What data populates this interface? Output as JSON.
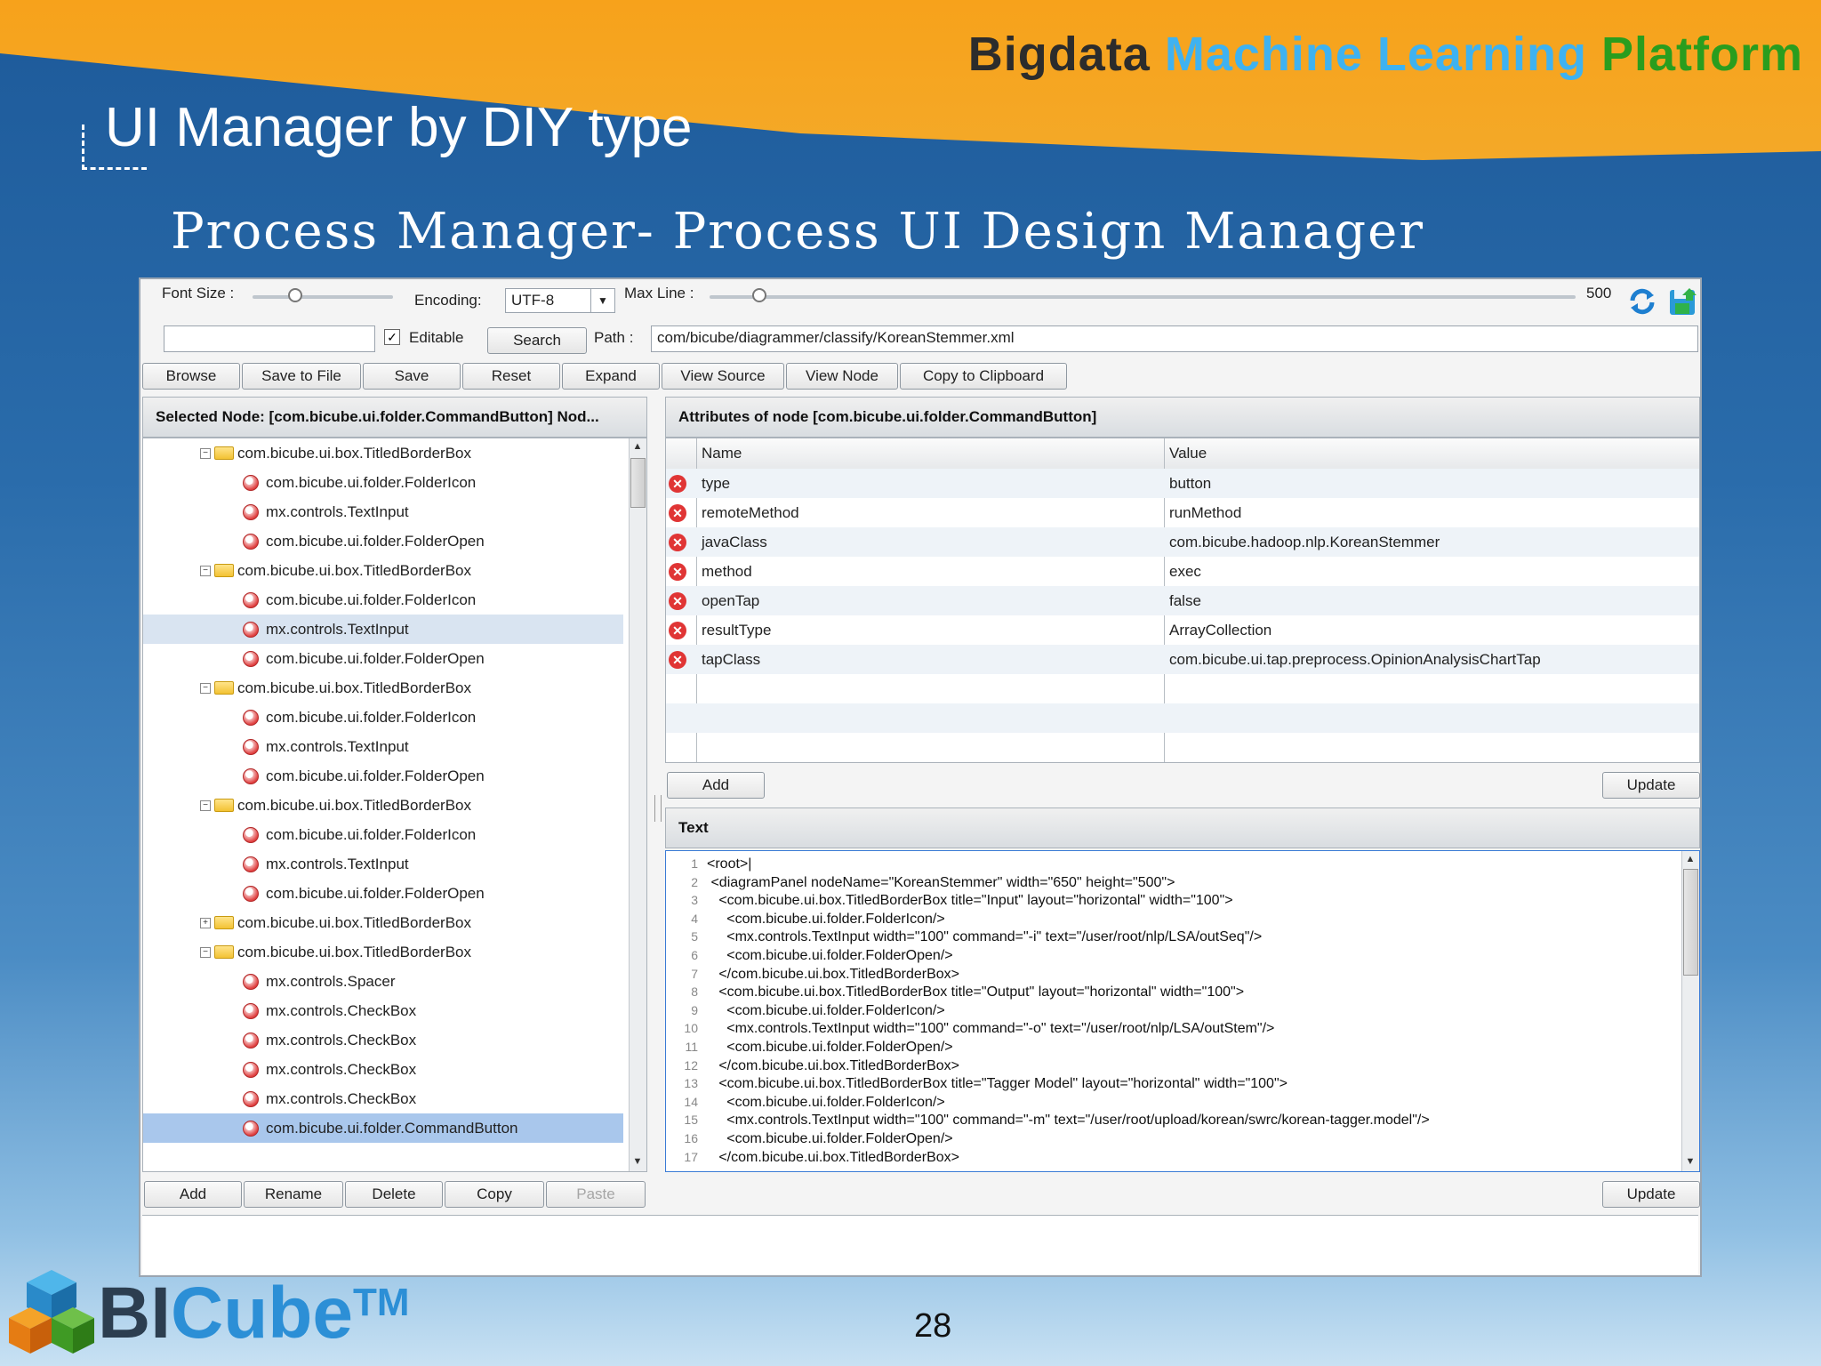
{
  "slide": {
    "brand": {
      "word1": "Bigdata",
      "word2": "Machine Learning",
      "word3": "Platform"
    },
    "heading": "UI Manager by DIY type",
    "subheading": "Process Manager- Process UI Design Manager",
    "page_number": "28",
    "logo": {
      "bi": "BI",
      "cube": "Cube",
      "tm": "TM"
    }
  },
  "toolbar": {
    "font_size_label": "Font Size :",
    "encoding_label": "Encoding:",
    "encoding_value": "UTF-8",
    "max_line_label": "Max Line :",
    "max_line_value": "500",
    "search_value": "",
    "editable_label": "Editable",
    "editable_checked": true,
    "search_button": "Search",
    "path_label": "Path :",
    "path_value": "com/bicube/diagrammer/classify/KoreanStemmer.xml",
    "buttons": [
      "Browse",
      "Save to File",
      "Save",
      "Reset",
      "Expand",
      "View Source",
      "View Node",
      "Copy to Clipboard"
    ]
  },
  "left_panel": {
    "title": "Selected Node: [com.bicube.ui.folder.CommandButton] Nod...",
    "tree": [
      {
        "label": "com.bicube.ui.box.TitledBorderBox",
        "kind": "folder",
        "expanded": true
      },
      {
        "label": "com.bicube.ui.folder.FolderIcon",
        "kind": "leaf"
      },
      {
        "label": "mx.controls.TextInput",
        "kind": "leaf"
      },
      {
        "label": "com.bicube.ui.folder.FolderOpen",
        "kind": "leaf"
      },
      {
        "label": "com.bicube.ui.box.TitledBorderBox",
        "kind": "folder",
        "expanded": true
      },
      {
        "label": "com.bicube.ui.folder.FolderIcon",
        "kind": "leaf"
      },
      {
        "label": "mx.controls.TextInput",
        "kind": "leaf",
        "state": "hover"
      },
      {
        "label": "com.bicube.ui.folder.FolderOpen",
        "kind": "leaf"
      },
      {
        "label": "com.bicube.ui.box.TitledBorderBox",
        "kind": "folder",
        "expanded": true
      },
      {
        "label": "com.bicube.ui.folder.FolderIcon",
        "kind": "leaf"
      },
      {
        "label": "mx.controls.TextInput",
        "kind": "leaf"
      },
      {
        "label": "com.bicube.ui.folder.FolderOpen",
        "kind": "leaf"
      },
      {
        "label": "com.bicube.ui.box.TitledBorderBox",
        "kind": "folder",
        "expanded": true
      },
      {
        "label": "com.bicube.ui.folder.FolderIcon",
        "kind": "leaf"
      },
      {
        "label": "mx.controls.TextInput",
        "kind": "leaf"
      },
      {
        "label": "com.bicube.ui.folder.FolderOpen",
        "kind": "leaf"
      },
      {
        "label": "com.bicube.ui.box.TitledBorderBox",
        "kind": "folder",
        "expanded": false
      },
      {
        "label": "com.bicube.ui.box.TitledBorderBox",
        "kind": "folder",
        "expanded": true
      },
      {
        "label": "mx.controls.Spacer",
        "kind": "leaf"
      },
      {
        "label": "mx.controls.CheckBox",
        "kind": "leaf"
      },
      {
        "label": "mx.controls.CheckBox",
        "kind": "leaf"
      },
      {
        "label": "mx.controls.CheckBox",
        "kind": "leaf"
      },
      {
        "label": "mx.controls.CheckBox",
        "kind": "leaf"
      },
      {
        "label": "com.bicube.ui.folder.CommandButton",
        "kind": "leaf",
        "state": "selected"
      }
    ],
    "buttons": [
      "Add",
      "Rename",
      "Delete",
      "Copy",
      "Paste"
    ]
  },
  "attributes_panel": {
    "title": "Attributes of node [com.bicube.ui.folder.CommandButton]",
    "columns": [
      "Name",
      "Value"
    ],
    "rows": [
      {
        "name": "type",
        "value": "button"
      },
      {
        "name": "remoteMethod",
        "value": "runMethod"
      },
      {
        "name": "javaClass",
        "value": "com.bicube.hadoop.nlp.KoreanStemmer"
      },
      {
        "name": "method",
        "value": "exec"
      },
      {
        "name": "openTap",
        "value": "false"
      },
      {
        "name": "resultType",
        "value": "ArrayCollection"
      },
      {
        "name": "tapClass",
        "value": "com.bicube.ui.tap.preprocess.OpinionAnalysisChartTap"
      }
    ],
    "add_button": "Add",
    "update_button": "Update"
  },
  "text_panel": {
    "title": "Text",
    "lines": [
      {
        "n": "1",
        "text": "<root>|"
      },
      {
        "n": "2",
        "text": " <diagramPanel nodeName=\"KoreanStemmer\" width=\"650\" height=\"500\">"
      },
      {
        "n": "3",
        "text": "   <com.bicube.ui.box.TitledBorderBox title=\"Input\" layout=\"horizontal\" width=\"100\">"
      },
      {
        "n": "4",
        "text": "     <com.bicube.ui.folder.FolderIcon/>"
      },
      {
        "n": "5",
        "text": "     <mx.controls.TextInput width=\"100\" command=\"-i\" text=\"/user/root/nlp/LSA/outSeq\"/>"
      },
      {
        "n": "6",
        "text": "     <com.bicube.ui.folder.FolderOpen/>"
      },
      {
        "n": "7",
        "text": "   </com.bicube.ui.box.TitledBorderBox>"
      },
      {
        "n": "8",
        "text": "   <com.bicube.ui.box.TitledBorderBox title=\"Output\" layout=\"horizontal\" width=\"100\">"
      },
      {
        "n": "9",
        "text": "     <com.bicube.ui.folder.FolderIcon/>"
      },
      {
        "n": "10",
        "text": "     <mx.controls.TextInput width=\"100\" command=\"-o\" text=\"/user/root/nlp/LSA/outStem\"/>"
      },
      {
        "n": "11",
        "text": "     <com.bicube.ui.folder.FolderOpen/>"
      },
      {
        "n": "12",
        "text": "   </com.bicube.ui.box.TitledBorderBox>"
      },
      {
        "n": "13",
        "text": "   <com.bicube.ui.box.TitledBorderBox title=\"Tagger Model\" layout=\"horizontal\" width=\"100\">"
      },
      {
        "n": "14",
        "text": "     <com.bicube.ui.folder.FolderIcon/>"
      },
      {
        "n": "15",
        "text": "     <mx.controls.TextInput width=\"100\" command=\"-m\" text=\"/user/root/upload/korean/swrc/korean-tagger.model\"/>"
      },
      {
        "n": "16",
        "text": "     <com.bicube.ui.folder.FolderOpen/>"
      },
      {
        "n": "17",
        "text": "   </com.bicube.ui.box.TitledBorderBox>"
      }
    ],
    "update_button": "Update"
  },
  "colors": {
    "orange_band": "#f7a21b",
    "brand_dark": "#2c2c2c",
    "brand_blue": "#3fb2f0",
    "brand_green": "#2a9d1e",
    "selection": "#a9c7ec"
  }
}
